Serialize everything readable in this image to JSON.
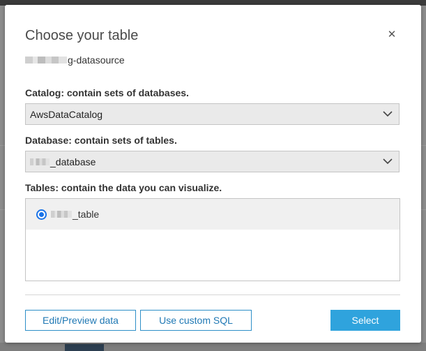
{
  "dialog": {
    "title": "Choose your table",
    "close_icon": "close-icon",
    "datasource_suffix": "g-datasource"
  },
  "catalog": {
    "label": "Catalog: contain sets of databases.",
    "selected": "AwsDataCatalog"
  },
  "database": {
    "label": "Database: contain sets of tables.",
    "selected_suffix": "_database"
  },
  "tables": {
    "label": "Tables: contain the data you can visualize.",
    "items": [
      {
        "name_suffix": "_table",
        "selected": true
      }
    ]
  },
  "footer": {
    "edit_preview_label": "Edit/Preview data",
    "custom_sql_label": "Use custom SQL",
    "select_label": "Select"
  },
  "colors": {
    "accent": "#2fa3dd",
    "radio": "#1a73e8",
    "outline_border": "#2e8fc8"
  }
}
